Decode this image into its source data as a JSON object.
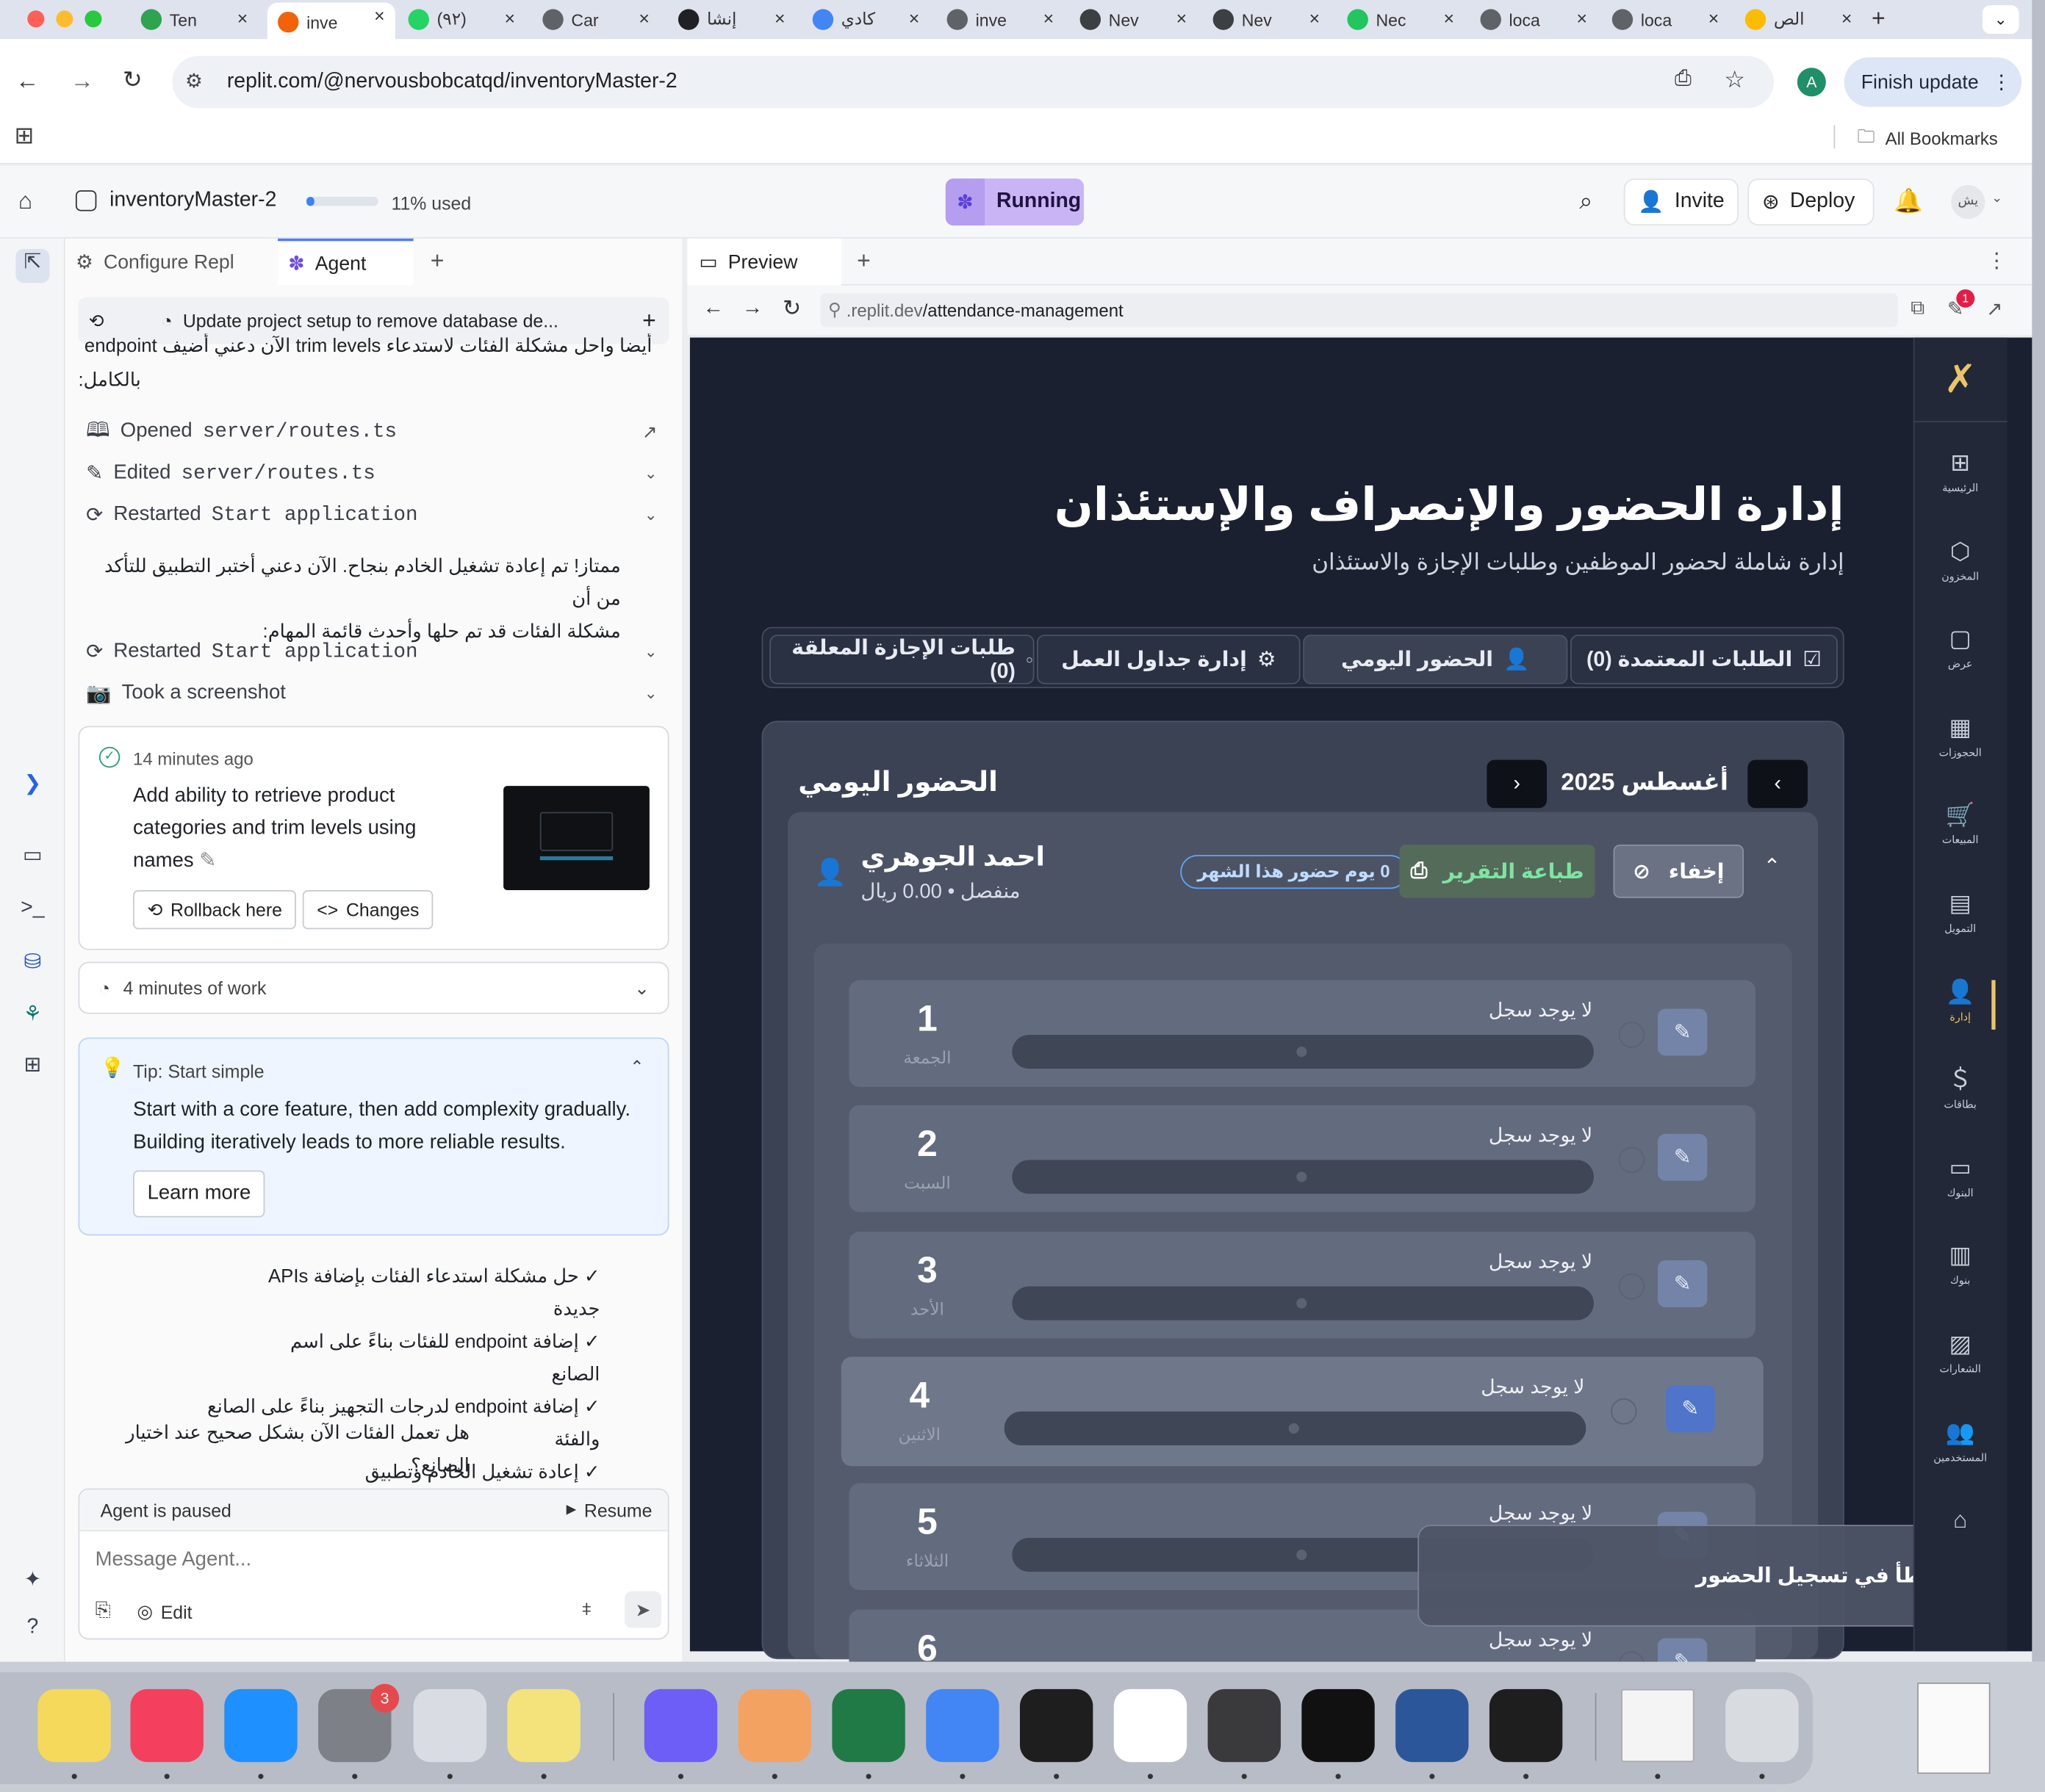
{
  "browser": {
    "tabs": [
      {
        "label": "Ten",
        "color": "#2ea44f"
      },
      {
        "label": "inve",
        "color": "#f26207"
      },
      {
        "label": "(٩٢)",
        "color": "#25d366"
      },
      {
        "label": "Car",
        "color": "#5f6368"
      },
      {
        "label": "إنشا",
        "color": "#202124"
      },
      {
        "label": "كادي",
        "color": "#4285f4"
      },
      {
        "label": "inve",
        "color": "#5f6368"
      },
      {
        "label": "Nev",
        "color": "#3c4043"
      },
      {
        "label": "Nev",
        "color": "#3c4043"
      },
      {
        "label": "Nec",
        "color": "#22c55e"
      },
      {
        "label": "loca",
        "color": "#5f6368"
      },
      {
        "label": "loca",
        "color": "#5f6368"
      },
      {
        "label": "الص",
        "color": "#fbbc04"
      }
    ],
    "url": "replit.com/@nervousbobcatqd/inventoryMaster-2",
    "avatar_letter": "A",
    "finish_update_label": "Finish update",
    "all_bookmarks_label": "All Bookmarks"
  },
  "replit": {
    "project_name": "inventoryMaster-2",
    "usage_label": "11% used",
    "usage_fraction": 0.11,
    "run_status": "Running",
    "invite_label": "Invite",
    "deploy_label": "Deploy",
    "user_initials": "يش"
  },
  "agent": {
    "tabs": {
      "configure": "Configure Repl",
      "agent": "Agent"
    },
    "session_title": "Update project setup to remove database de...",
    "intro_text_1": "أيضا واحل مشكلة الفئات لاستدعاء trim levels الآن دعني أضيف endpoint",
    "intro_text_2": "بالكامل:",
    "steps": [
      {
        "prefix": "Opened",
        "code": "server/routes.ts"
      },
      {
        "prefix": "Edited",
        "code": "server/routes.ts"
      },
      {
        "prefix": "Restarted",
        "code": "Start application"
      }
    ],
    "message_1_line_1": "ممتاز! تم إعادة تشغيل الخادم بنجاح. الآن دعني أختبر التطبيق للتأكد من أن",
    "message_1_line_2": "مشكلة الفئات قد تم حلها وأحدث قائمة المهام:",
    "steps_2": [
      {
        "prefix": "Restarted",
        "code": "Start application"
      },
      {
        "prefix": "Took a screenshot",
        "code": ""
      }
    ],
    "checkpoint": {
      "time": "14 minutes ago",
      "line_1": "Add ability to retrieve product",
      "line_2": "categories and trim levels using",
      "line_3": "names",
      "rollback_label": "Rollback here",
      "changes_label": "Changes"
    },
    "work_summary": "4 minutes of work",
    "tip": {
      "title": "Tip: Start simple",
      "line_1": "Start with a core feature, then add complexity gradually.",
      "line_2": "Building iteratively leads to more reliable results.",
      "learn_more_label": "Learn more"
    },
    "checklist": [
      "✓ حل مشكلة استدعاء الفئات بإضافة APIs جديدة",
      "✓ إضافة endpoint للفئات بناءً على اسم الصانع",
      "✓ إضافة endpoint لدرجات التجهيز بناءً على الصانع والفئة",
      "✓ إعادة تشغيل الخادم وتطبيق التغييرات"
    ],
    "question": "هل تعمل الفئات الآن بشكل صحيح عند اختيار الصانع؟",
    "paused_label": "Agent is paused",
    "resume_label": "Resume",
    "message_placeholder": "Message Agent...",
    "edit_label": "Edit"
  },
  "preview": {
    "tab_label": "Preview",
    "url_prefix": ".replit.dev",
    "url_path": "/attendance-management",
    "badge_count": "1"
  },
  "app": {
    "title": "إدارة الحضور والإنصراف والإستئذان",
    "subtitle": "إدارة شاملة لحضور الموظفين وطلبات الإجازة والاستئذان",
    "tabs": [
      {
        "label": "الطلبات المعتمدة (0)",
        "icon": "check-square-icon"
      },
      {
        "label": "الحضور اليومي",
        "icon": "user-check-icon"
      },
      {
        "label": "إدارة جداول العمل",
        "icon": "gear-icon"
      },
      {
        "label": "طلبات الإجازة المعلقة (0)",
        "icon": "dot-icon"
      }
    ],
    "section_title": "الحضور اليومي",
    "month_label": "أغسطس 2025",
    "employee": {
      "name": "احمد الجوهري",
      "details": "منفصل • 0.00 ريال",
      "attendance_badge": "0 يوم حضور هذا الشهر",
      "print_label": "طباعة التقرير",
      "hide_label": "إخفاء"
    },
    "days": [
      {
        "num": "1",
        "name": "الجمعة",
        "note": "لا يوجد سجل"
      },
      {
        "num": "2",
        "name": "السبت",
        "note": "لا يوجد سجل"
      },
      {
        "num": "3",
        "name": "الأحد",
        "note": "لا يوجد سجل"
      },
      {
        "num": "4",
        "name": "الاثنين",
        "note": "لا يوجد سجل"
      },
      {
        "num": "5",
        "name": "الثلاثاء",
        "note": "لا يوجد سجل"
      },
      {
        "num": "6",
        "name": "",
        "note": "لا يوجد سجل"
      }
    ],
    "toast": "خطأ في تسجيل الحضور",
    "sidebar": [
      {
        "label": "الرئيسية",
        "icon": "grid-icon"
      },
      {
        "label": "المخزون",
        "icon": "box-icon"
      },
      {
        "label": "عرض",
        "icon": "message-icon"
      },
      {
        "label": "الحجوزات",
        "icon": "calendar-icon"
      },
      {
        "label": "المبيعات",
        "icon": "cart-icon"
      },
      {
        "label": "التمويل",
        "icon": "calculator-icon"
      },
      {
        "label": "إدارة",
        "icon": "user-check-icon"
      },
      {
        "label": "بطاقات",
        "icon": "dollar-icon"
      },
      {
        "label": "البنوك",
        "icon": "card-icon"
      },
      {
        "label": "بنوك",
        "icon": "bank-icon"
      },
      {
        "label": "الشعارات",
        "icon": "image-icon"
      },
      {
        "label": "المستخدمين",
        "icon": "users-icon"
      }
    ],
    "accent": "#e9c46a"
  },
  "dock": {
    "apps": [
      {
        "name": "notes",
        "color": "#f5d95a"
      },
      {
        "name": "music",
        "color": "#f43f5e"
      },
      {
        "name": "app-store",
        "color": "#1e90ff"
      },
      {
        "name": "system-settings",
        "color": "#7d8086",
        "badge": "3"
      },
      {
        "name": "iphone-mirroring",
        "color": "#d9dce2"
      },
      {
        "name": "stickies",
        "color": "#f4e27a"
      },
      {
        "name": "screen-capture",
        "color": "#6d5ef7"
      },
      {
        "name": "color-app",
        "color": "#f4a261"
      },
      {
        "name": "excel",
        "color": "#1f7a45"
      },
      {
        "name": "chrome",
        "color": "#4285f4"
      },
      {
        "name": "figma",
        "color": "#1e1e1e"
      },
      {
        "name": "writer",
        "color": "#ffffff"
      },
      {
        "name": "calculator",
        "color": "#3a3a3c"
      },
      {
        "name": "terminal",
        "color": "#111111"
      },
      {
        "name": "word",
        "color": "#2b579a"
      },
      {
        "name": "package-app",
        "color": "#1e1e1e"
      },
      {
        "name": "document-preview",
        "color": "#f4f4f4"
      },
      {
        "name": "trash",
        "color": "#d8dbe0"
      }
    ]
  }
}
